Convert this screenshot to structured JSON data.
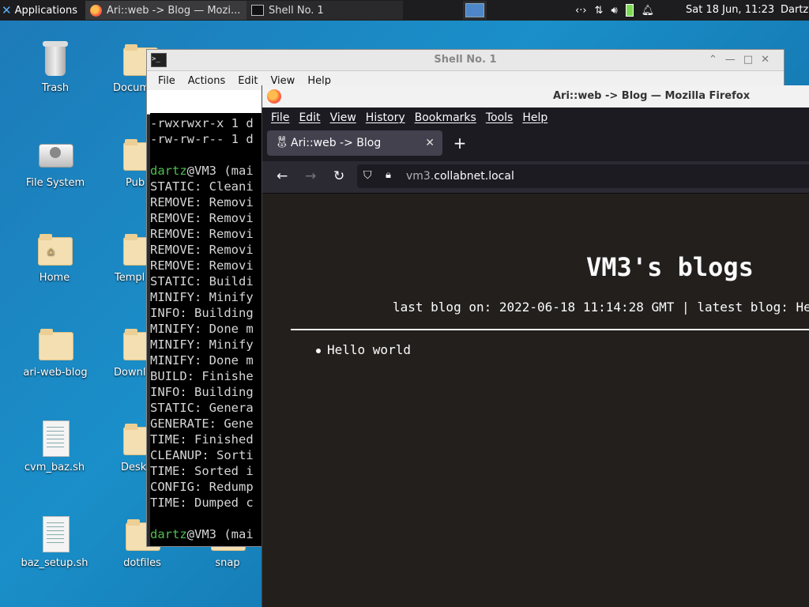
{
  "panel": {
    "applications_label": "Applications",
    "tasks": [
      {
        "label": "Ari::web -> Blog — Mozi..."
      },
      {
        "label": "Shell No. 1"
      }
    ],
    "clock": "Sat 18 Jun, 11:23",
    "user": "Dartz"
  },
  "desktop": {
    "col1": [
      "Trash",
      "File System",
      "Home",
      "ari-web-blog",
      "cvm_baz.sh",
      "baz_setup.sh"
    ],
    "col2": [
      "Docum",
      "Pub",
      "Templ",
      "Downl",
      "Desk",
      "dotfiles"
    ],
    "col3": [
      "snap"
    ]
  },
  "terminal": {
    "title": "Shell No. 1",
    "menu": [
      "File",
      "Actions",
      "Edit",
      "View",
      "Help"
    ],
    "lines": [
      {
        "text": "-rwxrwxr-x 1 d"
      },
      {
        "text": "-rw-rw-r-- 1 d"
      },
      {
        "text": ""
      },
      {
        "prompt_user": "dartz",
        "text": "@VM3 (mai"
      },
      {
        "text": "STATIC: Cleani"
      },
      {
        "text": "REMOVE: Removi"
      },
      {
        "text": "REMOVE: Removi"
      },
      {
        "text": "REMOVE: Removi"
      },
      {
        "text": "REMOVE: Removi"
      },
      {
        "text": "REMOVE: Removi"
      },
      {
        "text": "STATIC: Buildi"
      },
      {
        "text": "MINIFY: Minify"
      },
      {
        "text": "INFO: Building"
      },
      {
        "text": "MINIFY: Done m"
      },
      {
        "text": "MINIFY: Minify"
      },
      {
        "text": "MINIFY: Done m"
      },
      {
        "text": "BUILD: Finishe"
      },
      {
        "text": "INFO: Building"
      },
      {
        "text": "STATIC: Genera"
      },
      {
        "text": "GENERATE: Gene"
      },
      {
        "text": "TIME: Finished"
      },
      {
        "text": "CLEANUP: Sorti"
      },
      {
        "text": "TIME: Sorted i"
      },
      {
        "text": "CONFIG: Redump"
      },
      {
        "text": "TIME: Dumped c"
      },
      {
        "text": ""
      },
      {
        "prompt_user": "dartz",
        "text": "@VM3 (mai"
      }
    ]
  },
  "firefox": {
    "title": "Ari::web -> Blog — Mozilla Firefox",
    "menu": [
      "File",
      "Edit",
      "View",
      "History",
      "Bookmarks",
      "Tools",
      "Help"
    ],
    "tab_label": "Ari::web -> Blog",
    "url_host_prefix": "vm3.",
    "url_domain": "collabnet.local",
    "page": {
      "heading": "VM3's blogs",
      "meta": "last blog on: 2022-06-18 11:14:28 GMT | latest blog: He",
      "posts": [
        "Hello world"
      ]
    }
  }
}
